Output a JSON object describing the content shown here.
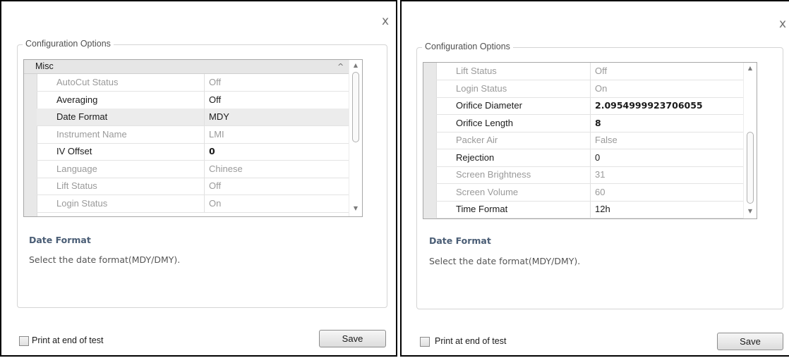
{
  "close_glyph": "x",
  "group_label": "Configuration Options",
  "left_panel": {
    "category": "Misc",
    "category_caret": "^",
    "rows": [
      {
        "name": "AutoCut Status",
        "value": "Off",
        "disabled": true,
        "bold": false
      },
      {
        "name": "Averaging",
        "value": "Off",
        "disabled": false,
        "bold": false
      },
      {
        "name": "Date Format",
        "value": "MDY",
        "disabled": false,
        "bold": false,
        "selected": true
      },
      {
        "name": "Instrument Name",
        "value": "LMI",
        "disabled": true,
        "bold": false
      },
      {
        "name": "IV Offset",
        "value": "0",
        "disabled": false,
        "bold": true
      },
      {
        "name": "Language",
        "value": "Chinese",
        "disabled": true,
        "bold": false
      },
      {
        "name": "Lift Status",
        "value": "Off",
        "disabled": true,
        "bold": false
      },
      {
        "name": "Login Status",
        "value": "On",
        "disabled": true,
        "bold": false
      }
    ],
    "scroll_position": 0.0
  },
  "right_panel": {
    "rows": [
      {
        "name": "Lift Status",
        "value": "Off",
        "disabled": true,
        "bold": false
      },
      {
        "name": "Login Status",
        "value": "On",
        "disabled": true,
        "bold": false
      },
      {
        "name": "Orifice Diameter",
        "value": "2.0954999923706055",
        "disabled": false,
        "bold": true
      },
      {
        "name": "Orifice Length",
        "value": "8",
        "disabled": false,
        "bold": true
      },
      {
        "name": "Packer Air",
        "value": "False",
        "disabled": true,
        "bold": false
      },
      {
        "name": "Rejection",
        "value": "0",
        "disabled": false,
        "bold": false
      },
      {
        "name": "Screen Brightness",
        "value": "31",
        "disabled": true,
        "bold": false
      },
      {
        "name": "Screen Volume",
        "value": "60",
        "disabled": true,
        "bold": false
      },
      {
        "name": "Time Format",
        "value": "12h",
        "disabled": false,
        "bold": false
      }
    ],
    "scroll_position": 1.0
  },
  "description": {
    "title": "Date Format",
    "text": "Select the date format(MDY/DMY)."
  },
  "print_checkbox": {
    "label": "Print at end of test",
    "checked": false
  },
  "save_label": "Save",
  "scroll_up_glyph": "▲",
  "scroll_down_glyph": "▼"
}
